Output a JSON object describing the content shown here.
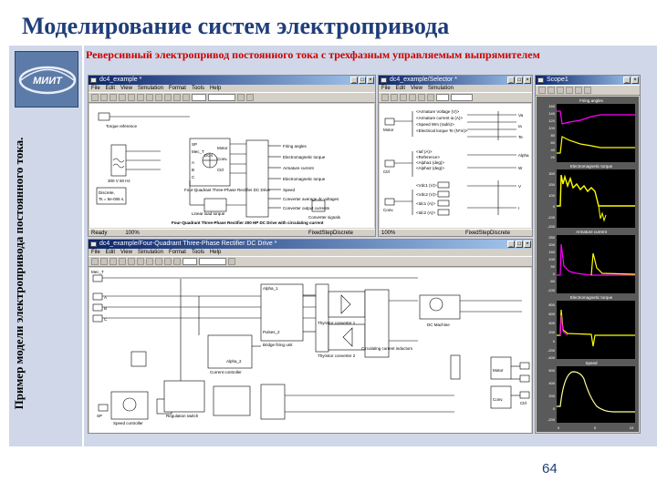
{
  "slide": {
    "title": "Моделирование систем электропривода",
    "subtitle": "Реверсивный электропривод постоянного тока с трехфазным управляемым выпрямителем",
    "vertical_caption": "Пример модели электропривода постоянного тока.",
    "page_number": "64",
    "logo_text": "МИИТ"
  },
  "colors": {
    "title": "#1f3e7a",
    "subtitle": "#cc0000",
    "panel": "#cfd7e8",
    "scope_bg": "#000000",
    "scope_trace_yellow": "#ffff00",
    "scope_trace_magenta": "#ff00ff"
  },
  "window1": {
    "title": "dc4_example *",
    "menu": [
      "File",
      "Edit",
      "View",
      "Simulation",
      "Format",
      "Tools",
      "Help"
    ],
    "zoom": "100%",
    "status_left": "Ready",
    "status_zoom": "100%",
    "status_solver": "FixedStepDiscrete",
    "blocks": {
      "torque_reference": "Torque reference",
      "source": "300 V 50 Hz",
      "drive_name": "DC4",
      "drive_caption": "Four-Quadrant Three-Phase Rectifier DC Drive",
      "load": "Linear load torque",
      "discrete": "Discrete,",
      "ts": "Ts = 5e-006 s.",
      "converter_signals": "Converter signals",
      "bottom_caption": "Four-Quadrant Three-Phase Rectifier 200 HP DC Drive with circulating current",
      "signals": [
        "Firing angles",
        "Electromagnetic torque",
        "Armature current",
        "Electromagnetic torque",
        "Speed",
        "Converter average dc voltages",
        "Converter output currents"
      ],
      "ports": [
        "SP",
        "Mec_T",
        "A",
        "B",
        "C",
        "Mec_T",
        "Motor",
        "Conv.",
        "Ctrl"
      ]
    }
  },
  "window2": {
    "title": "dc4_example/Selector *",
    "menu": [
      "File",
      "Edit",
      "View",
      "Simulation",
      "Format",
      "Tools",
      "Help"
    ],
    "status_zoom": "100%",
    "status_solver": "FixedStepDiscrete",
    "inputs": [
      "Motor",
      "Ctrl",
      "Conv."
    ],
    "outputs": [
      "Va",
      "Ia",
      "Alpha",
      "Te",
      "W",
      "V",
      "I"
    ],
    "signal_labels": [
      "<Armature Voltage (V)>",
      "<Armature current ia (A)>",
      "<Speed Wm (rad/s)>",
      "<Electrical torque Te (N*m)>",
      "<Iaf (A)>",
      "<Reference>",
      "<Alpha1 (deg)>",
      "<Alpha2 (deg)>",
      "<Vdc1 (V)>",
      "<Vdc2 (V)>",
      "<Idc1 (A)>",
      "<Idc2 (A)>"
    ]
  },
  "window3": {
    "title": "dc4_example/Four-Quadrant Three-Phase Rectifier DC Drive *",
    "menu": [
      "File",
      "Edit",
      "View",
      "Simulation",
      "Format",
      "Tools",
      "Help"
    ],
    "zoom": "100%",
    "blocks": {
      "mec_t": "Mec_T",
      "thyristor1": "Thyristor converter 1",
      "thyristor2": "Thyristor converter 2",
      "circulating": "Circulating current inductors",
      "dc_machine": "DC Machine",
      "bridge": "Bridge firing unit",
      "current_controller": "Current controller",
      "speed_controller": "Speed controller",
      "regulation_switch": "Regulation switch",
      "pulses": "Pulses_2",
      "alpha1": "Alpha_1",
      "alpha2": "Alpha_2",
      "ports_left": [
        "SP",
        "Mec_T",
        "A",
        "B",
        "C"
      ],
      "ports_right": [
        "Motor",
        "Conv.",
        "Ctrl"
      ]
    }
  },
  "scope": {
    "title": "Scope1",
    "panels": [
      {
        "title": "Firing angles",
        "yticks": [
          "160",
          "140",
          "120",
          "100",
          "80",
          "60",
          "40",
          "20"
        ]
      },
      {
        "title": "Electromagnetic torque",
        "yticks": [
          "300",
          "200",
          "100",
          "0",
          "-100",
          "-200"
        ]
      },
      {
        "title": "Armature current",
        "yticks": [
          "250",
          "200",
          "150",
          "100",
          "50",
          "0",
          "-50",
          "-100"
        ]
      },
      {
        "title": "Electromagnetic torque",
        "yticks": [
          "800",
          "600",
          "400",
          "200",
          "0",
          "-200",
          "-400"
        ]
      },
      {
        "title": "Speed",
        "yticks": [
          "600",
          "400",
          "200",
          "0",
          "-200"
        ]
      }
    ],
    "xticks": [
      "0",
      "5",
      "10"
    ]
  }
}
